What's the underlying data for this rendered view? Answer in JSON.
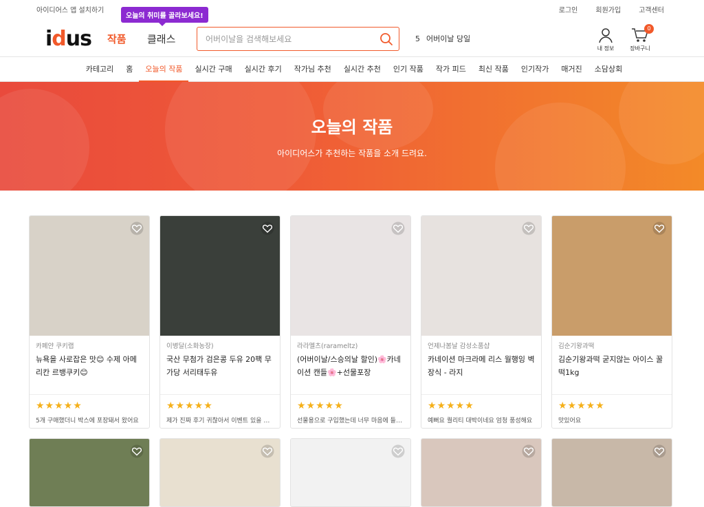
{
  "topbar": {
    "app_install": "아이디어스 앱 설치하기",
    "login": "로그인",
    "signup": "회원가입",
    "help": "고객센터"
  },
  "header": {
    "logo": "idus",
    "tab_works": "작품",
    "tab_class": "클래스",
    "tooltip": "오늘의 취미를 골라보세요!",
    "search_placeholder": "어버이날을 검색해보세요",
    "trending_rank": "5",
    "trending_text": "어버이날 당일",
    "my_info": "내 정보",
    "cart": "장바구니",
    "cart_count": "0"
  },
  "nav": [
    "카테고리",
    "홈",
    "오늘의 작품",
    "실시간 구매",
    "실시간 후기",
    "작가님 추천",
    "실시간 추천",
    "인기 작품",
    "작가 피드",
    "최신 작품",
    "인기작가",
    "매거진",
    "소담상회"
  ],
  "hero": {
    "title": "오늘의 작품",
    "subtitle": "아이디어스가 추천하는 작품을 소개 드려요."
  },
  "products": [
    {
      "artist": "카페얀 쿠키랩",
      "title": "뉴욕을 사로잡은 맛😊 수제 아메리칸 르뱅쿠키😊",
      "stars": "★★★★★",
      "review": "5개 구매했더니 박스에 포장돼서 왔어요",
      "bg": "#d8d2c8"
    },
    {
      "artist": "이병달(소화농장)",
      "title": "국산 무첨가 검은콩 두유 20팩 무가당 서리태두유",
      "stars": "★★★★★",
      "review": "제가 진짜 후기 귀찮아서 이벤트 있을 때만",
      "bg": "#3a3f3a"
    },
    {
      "artist": "라라멜츠(rarameltz)",
      "title": "(어버이날/스승의날 할인)🌸카네이션 캔들🌸+선물포장",
      "stars": "★★★★★",
      "review": "선물용으로 구입했는데 너무 마음에 들어요",
      "bg": "#e9e4e4"
    },
    {
      "artist": "언제나봄날 감성소품샵",
      "title": "카네이션 마크라메 리스 월행잉 벽장식 - 라지",
      "stars": "★★★★★",
      "review": "예뻐요 퀄리티 대박이네요 엄청 풍성해요",
      "bg": "#e7e2df"
    },
    {
      "artist": "김순기왕과떡",
      "title": "김순기왕과떡 굳지않는 아이스 꿀떡1kg",
      "stars": "★★★★★",
      "review": "맛있어요",
      "bg": "#c99d6a"
    }
  ],
  "second_row_bgs": [
    "#6f7e55",
    "#e8e0d0",
    "#f2f2f2",
    "#d9c7bd",
    "#c8b8a8"
  ]
}
